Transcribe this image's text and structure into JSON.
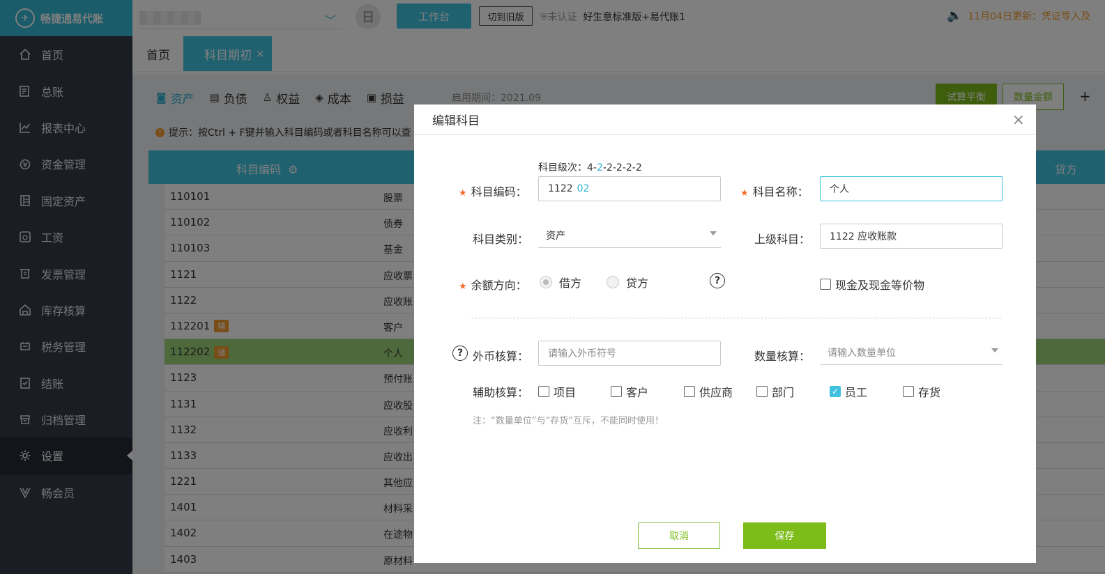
{
  "app": {
    "name": "畅捷通易代账"
  },
  "sidebar": {
    "items": [
      {
        "label": "首页",
        "icon": "home-icon"
      },
      {
        "label": "总账",
        "icon": "ledger-icon"
      },
      {
        "label": "报表中心",
        "icon": "report-icon"
      },
      {
        "label": "资金管理",
        "icon": "money-icon"
      },
      {
        "label": "固定资产",
        "icon": "asset-icon"
      },
      {
        "label": "工资",
        "icon": "salary-icon"
      },
      {
        "label": "发票管理",
        "icon": "invoice-icon"
      },
      {
        "label": "库存核算",
        "icon": "inventory-icon"
      },
      {
        "label": "税务管理",
        "icon": "tax-icon"
      },
      {
        "label": "结账",
        "icon": "close-account-icon"
      },
      {
        "label": "归档管理",
        "icon": "archive-icon"
      },
      {
        "label": "设置",
        "icon": "gear-icon",
        "active": true
      },
      {
        "label": "畅会员",
        "icon": "vip-icon"
      }
    ]
  },
  "topbar": {
    "calendar_glyph": "日",
    "workbench": "工作台",
    "old_version": "切到旧版",
    "cert_status": "未认证",
    "edition": "好生意标准版+易代账1",
    "notice": "11月04日更新：凭证导入及"
  },
  "tabs": {
    "home": "首页",
    "active": "科目期初",
    "close": "×"
  },
  "content": {
    "account_tabs": [
      {
        "label": "资产",
        "active": true
      },
      {
        "label": "负债"
      },
      {
        "label": "权益"
      },
      {
        "label": "成本"
      },
      {
        "label": "损益"
      }
    ],
    "start_period": "启用期间：2021.09",
    "trial_balance": "试算平衡",
    "qty_amount": "数量金额",
    "plus": "+",
    "tip": "提示：按Ctrl + F键并输入科目编码或者科目名称可以查",
    "grid": {
      "code_header": "科目编码",
      "credit_header": "贷方"
    },
    "rows": [
      {
        "code": "110101",
        "name": "股票"
      },
      {
        "code": "110102",
        "name": "债券"
      },
      {
        "code": "110103",
        "name": "基金"
      },
      {
        "code": "1121",
        "name": "应收票"
      },
      {
        "code": "1122",
        "name": "应收账"
      },
      {
        "code": "112201",
        "name": "客户",
        "aux": "辅"
      },
      {
        "code": "112202",
        "name": "个人",
        "aux": "辅",
        "selected": true
      },
      {
        "code": "1123",
        "name": "预付账"
      },
      {
        "code": "1131",
        "name": "应收股"
      },
      {
        "code": "1132",
        "name": "应收利"
      },
      {
        "code": "1133",
        "name": "应收出"
      },
      {
        "code": "1221",
        "name": "其他应"
      },
      {
        "code": "1401",
        "name": "材料采"
      },
      {
        "code": "1402",
        "name": "在途物"
      },
      {
        "code": "1403",
        "name": "原材料"
      }
    ]
  },
  "modal": {
    "title": "编辑科目",
    "close": "×",
    "level_label": "科目级次：",
    "level_a": "4-",
    "level_b": "2",
    "level_c": "-2-2-2-2",
    "code_label": "科目编码：",
    "code_prefix": "1122",
    "code_suffix": "02",
    "name_label": "科目名称：",
    "name_value": "个人",
    "category_label": "科目类别：",
    "category_value": "资产",
    "parent_label": "上级科目：",
    "parent_value": "1122 应收账款",
    "direction_label": "余额方向：",
    "debit": "借方",
    "credit": "贷方",
    "help": "?",
    "cash_equiv": "现金及现金等价物",
    "fx_label": "外币核算：",
    "fx_placeholder": "请输入外币符号",
    "qty_label": "数量核算：",
    "qty_placeholder": "请输入数量单位",
    "aux_label": "辅助核算：",
    "aux_options": [
      {
        "label": "项目",
        "checked": false
      },
      {
        "label": "客户",
        "checked": false
      },
      {
        "label": "供应商",
        "checked": false
      },
      {
        "label": "部门",
        "checked": false
      },
      {
        "label": "员工",
        "checked": true
      },
      {
        "label": "存货",
        "checked": false
      }
    ],
    "check_glyph": "✓",
    "note": "注：“数量单位”与“存货”互斥，不能同时使用！",
    "cancel": "取消",
    "save": "保存"
  }
}
